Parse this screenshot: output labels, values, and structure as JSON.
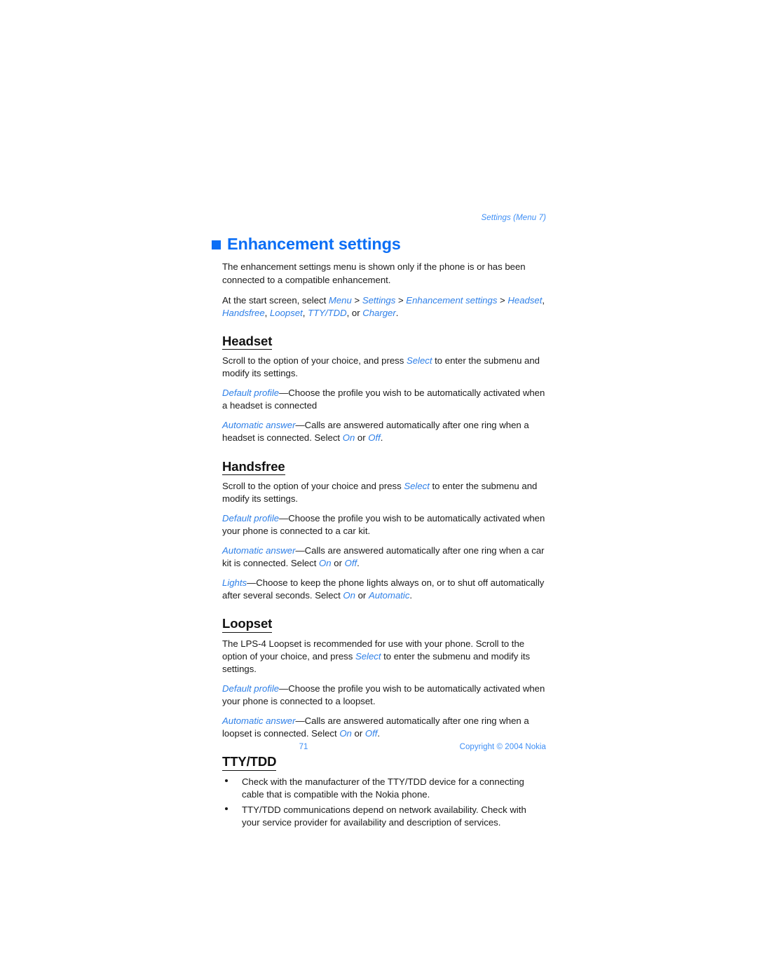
{
  "colors": {
    "accent_blue": "#0b6ef5",
    "inline_blue": "#2f80e8",
    "footer_blue": "#3d8ef5",
    "body_text": "#1a1a1a",
    "page_background": "#ffffff"
  },
  "running_header": "Settings (Menu 7)",
  "chapter": {
    "bullet_icon": "square-bullet-icon",
    "title": "Enhancement settings"
  },
  "intro": {
    "paragraph_1": "The enhancement settings menu is shown only if the phone is or has been connected to a compatible enhancement.",
    "path_line": {
      "lead": "At the start screen, select ",
      "menu": "Menu",
      "sep_1": " > ",
      "settings": "Settings",
      "sep_2": " > ",
      "enhancement_settings": "Enhancement settings",
      "sep_3": " > ",
      "headset": "Headset",
      "comma_1": ", ",
      "handsfree": "Handsfree",
      "comma_2": ", ",
      "loopset": "Loopset",
      "comma_3": ", ",
      "tty_tdd": "TTY/TDD",
      "or_text": ", or ",
      "charger": "Charger",
      "period": "."
    }
  },
  "sections": {
    "headset": {
      "heading": "Headset",
      "p1": {
        "a": "Scroll to the option of your choice, and press ",
        "select": "Select",
        "b": " to enter the submenu and modify its settings."
      },
      "p2": {
        "term": "Default profile",
        "rest": "—Choose the profile you wish to be automatically activated when a headset is connected"
      },
      "p3": {
        "term": "Automatic answer",
        "rest": "—Calls are answered automatically after one ring when a headset is connected. Select ",
        "on": "On",
        "or": " or ",
        "off": "Off",
        "period": "."
      }
    },
    "handsfree": {
      "heading": "Handsfree",
      "p1": {
        "a": "Scroll to the option of your choice and press ",
        "select": "Select",
        "b": " to enter the submenu and modify its settings."
      },
      "p2": {
        "term": "Default profile",
        "rest": "—Choose the profile you wish to be automatically activated when your phone is connected to a car kit."
      },
      "p3": {
        "term": "Automatic answer",
        "rest": "—Calls are answered automatically after one ring when a car kit is connected. Select ",
        "on": "On",
        "or": " or ",
        "off": "Off",
        "period": "."
      },
      "p4": {
        "term": "Lights",
        "rest": "—Choose to keep the phone lights always on, or to shut off automatically after several seconds. Select ",
        "on": "On",
        "or": " or ",
        "automatic": "Automatic",
        "period": "."
      }
    },
    "loopset": {
      "heading": "Loopset",
      "p1": {
        "a": "The LPS-4 Loopset is recommended for use with your phone. Scroll to the option of your choice, and press ",
        "select": "Select",
        "b": " to enter the submenu and modify its settings."
      },
      "p2": {
        "term": "Default profile",
        "rest": "—Choose the profile you wish to be automatically activated when your phone is connected to a loopset."
      },
      "p3": {
        "term": "Automatic answer",
        "rest": "—Calls are answered automatically after one ring when a loopset is connected. Select ",
        "on": "On",
        "or": " or ",
        "off": "Off",
        "period": "."
      }
    },
    "tty_tdd": {
      "heading": "TTY/TDD",
      "bullets": [
        "Check with the manufacturer of the TTY/TDD device for a connecting cable that is compatible with the Nokia phone.",
        "TTY/TDD communications depend on network availability. Check with your service provider for availability and description of services."
      ]
    }
  },
  "footer": {
    "page_number": "71",
    "copyright": "Copyright © 2004 Nokia"
  }
}
